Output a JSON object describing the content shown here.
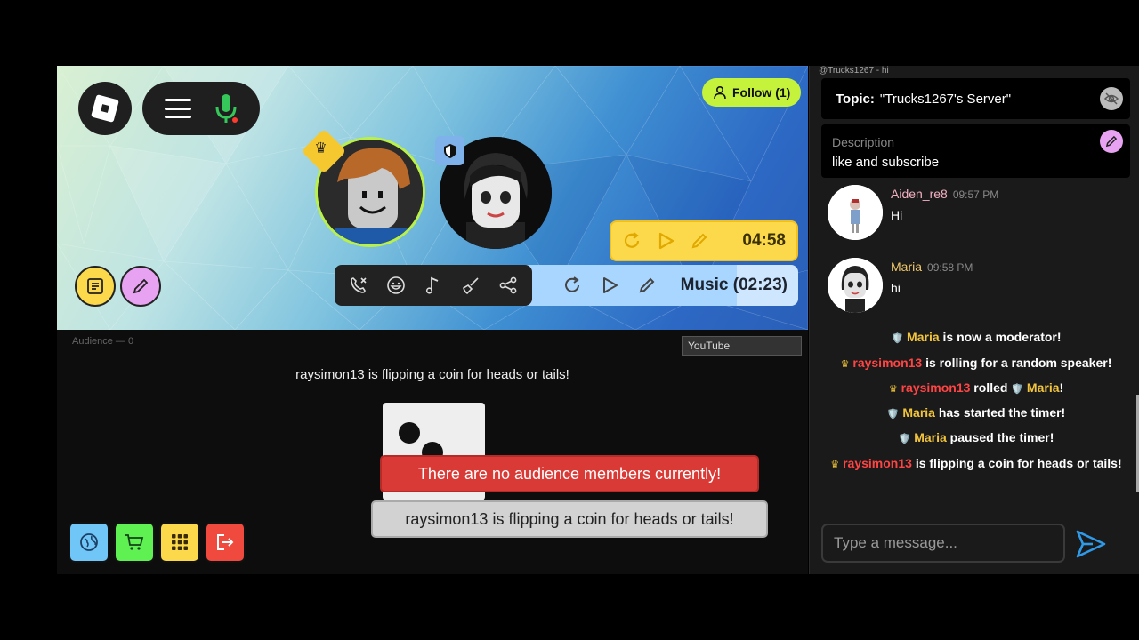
{
  "stage": {
    "follow_label": "Follow (1)",
    "timer": "04:58",
    "music_label": "Music (02:23)"
  },
  "lower": {
    "audience_label": "Audience — 0",
    "youtube_placeholder": "YouTube",
    "flip_message": "raysimon13 is flipping a coin for heads or tails!",
    "toast_error": "There are no audience members currently!",
    "toast_info": "raysimon13 is flipping a coin for heads or tails!"
  },
  "chat": {
    "top_line_user": "@Trucks1267",
    "top_line_text": " - hi",
    "topic_label": "Topic:",
    "topic_value": "\"Trucks1267's Server\"",
    "description_label": "Description",
    "description_value": "like and subscribe",
    "messages": [
      {
        "name": "Aiden_re8",
        "time": "09:57 PM",
        "text": "Hi"
      },
      {
        "name": "Maria",
        "time": "09:58 PM",
        "text": "hi"
      }
    ],
    "system": [
      {
        "user": "Maria",
        "text": " is now a moderator!"
      },
      {
        "user": "raysimon13",
        "text": " is rolling for a random speaker!"
      },
      {
        "user": "raysimon13",
        "text": " rolled ",
        "target": "Maria",
        "end": "!"
      },
      {
        "user": "Maria",
        "text": " has started the timer!"
      },
      {
        "user": "Maria",
        "text": " paused the timer!"
      },
      {
        "user": "raysimon13",
        "text": " is flipping a coin for heads or tails!"
      }
    ],
    "input_placeholder": "Type a message..."
  },
  "icons": {
    "crown": "crown-icon",
    "shield": "shield-icon",
    "mic": "microphone-icon"
  },
  "colors": {
    "follow": "#c5f23b",
    "timer": "#fcd94a",
    "music": "#a9d6ff",
    "error": "#d93a35",
    "moderator": "#f2c53d",
    "owner": "#ff4444"
  }
}
